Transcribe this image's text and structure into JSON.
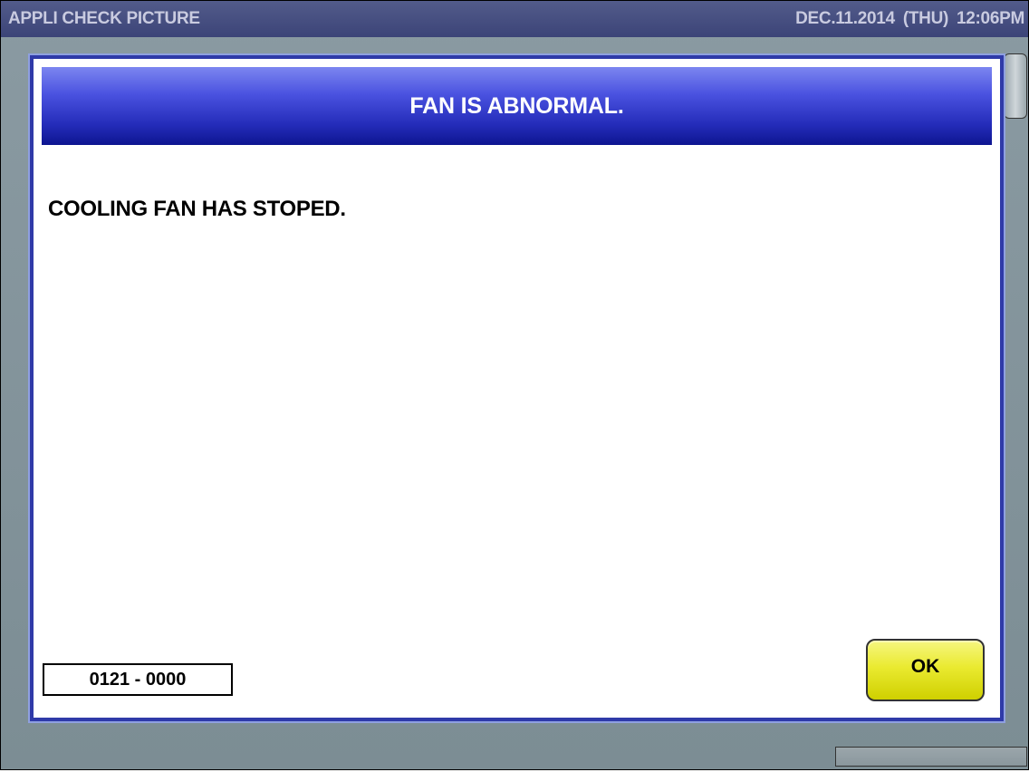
{
  "titlebar": {
    "app_title": "APPLI CHECK PICTURE",
    "datetime": "DEC.11.2014 (THU) 12:06PM"
  },
  "dialog": {
    "title": "FAN IS ABNORMAL.",
    "message": "COOLING FAN HAS STOPED.",
    "error_code": "0121 - 0000",
    "ok_label": "OK"
  },
  "colors": {
    "title_bar": "#3c4478",
    "dialog_border": "#2f3aa8",
    "dialog_header": "#232bb8",
    "ok_button": "#eaea30",
    "background": "#818f96"
  }
}
